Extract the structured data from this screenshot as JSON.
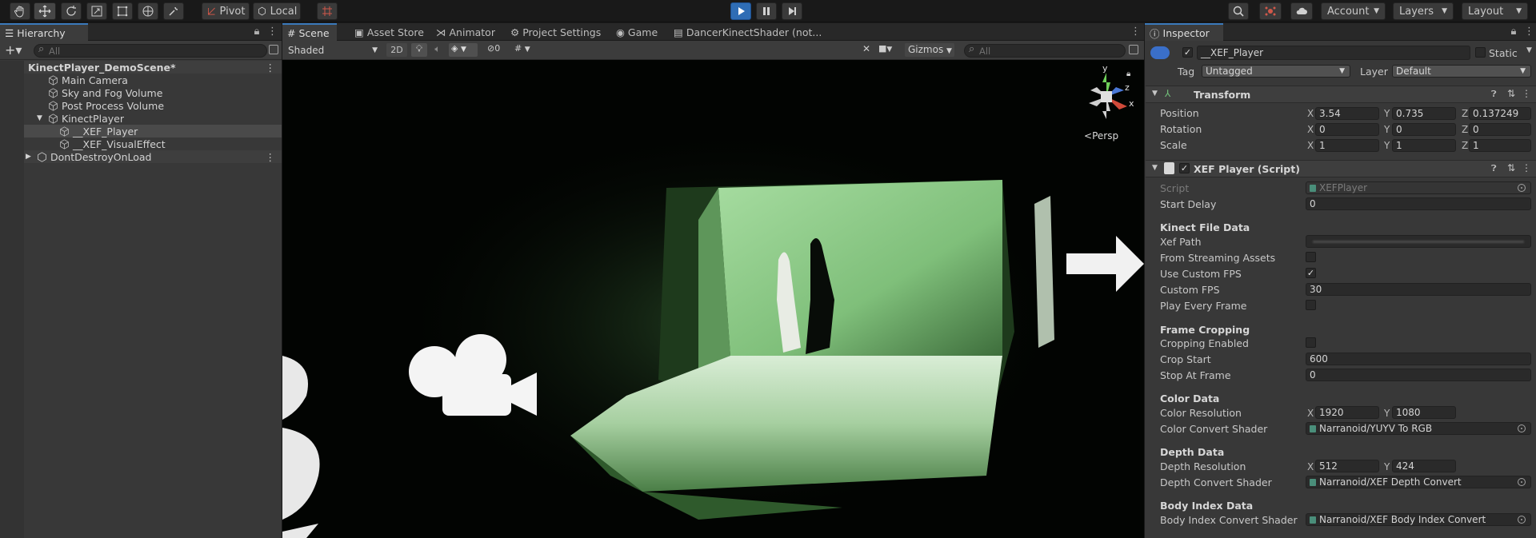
{
  "toolbar": {
    "pivot": "Pivot",
    "local": "Local",
    "account": "Account",
    "layers": "Layers",
    "layout": "Layout"
  },
  "hierarchy": {
    "tab": "Hierarchy",
    "search_placeholder": "All",
    "items": [
      {
        "label": "KinectPlayer_DemoScene*"
      },
      {
        "label": "Main Camera"
      },
      {
        "label": "Sky and Fog Volume"
      },
      {
        "label": "Post Process Volume"
      },
      {
        "label": "KinectPlayer"
      },
      {
        "label": "__XEF_Player"
      },
      {
        "label": "__XEF_VisualEffect"
      },
      {
        "label": "DontDestroyOnLoad"
      }
    ]
  },
  "scene": {
    "tabs": [
      "Scene",
      "Asset Store",
      "Animator",
      "Project Settings",
      "Game",
      "DancerKinectShader (not..."
    ],
    "shading": "Shaded",
    "mode_2d": "2D",
    "hidden_count": "0",
    "gizmos": "Gizmos",
    "search_placeholder": "All",
    "persp": "Persp",
    "axis_labels": {
      "y": "y",
      "z": "z",
      "x": "x"
    }
  },
  "inspector": {
    "tab": "Inspector",
    "object_name": "__XEF_Player",
    "static_label": "Static",
    "tag_label": "Tag",
    "tag_value": "Untagged",
    "layer_label": "Layer",
    "layer_value": "Default",
    "transform": {
      "title": "Transform",
      "position_label": "Position",
      "rotation_label": "Rotation",
      "scale_label": "Scale",
      "position": {
        "x": "3.54",
        "y": "0.735",
        "z": "0.137249"
      },
      "rotation": {
        "x": "0",
        "y": "0",
        "z": "0"
      },
      "scale": {
        "x": "1",
        "y": "1",
        "z": "1"
      }
    },
    "xef": {
      "title": "XEF Player (Script)",
      "script_label": "Script",
      "script_value": "XEFPlayer",
      "start_delay_label": "Start Delay",
      "start_delay": "0",
      "kinect_header": "Kinect File Data",
      "xef_path_label": "Xef Path",
      "from_streaming_label": "From Streaming Assets",
      "use_custom_fps_label": "Use Custom FPS",
      "custom_fps_label": "Custom FPS",
      "custom_fps": "30",
      "play_every_frame_label": "Play Every Frame",
      "cropping_header": "Frame Cropping",
      "cropping_enabled_label": "Cropping Enabled",
      "crop_start_label": "Crop Start",
      "crop_start": "600",
      "stop_at_label": "Stop At Frame",
      "stop_at": "0",
      "color_header": "Color Data",
      "color_res_label": "Color Resolution",
      "color_res": {
        "x": "1920",
        "y": "1080"
      },
      "color_shader_label": "Color Convert Shader",
      "color_shader": "Narranoid/YUYV To RGB",
      "depth_header": "Depth Data",
      "depth_res_label": "Depth Resolution",
      "depth_res": {
        "x": "512",
        "y": "424"
      },
      "depth_shader_label": "Depth Convert Shader",
      "depth_shader": "Narranoid/XEF Depth Convert",
      "body_header": "Body Index Data",
      "body_shader_label": "Body Index Convert Shader",
      "body_shader": "Narranoid/XEF Body Index Convert"
    },
    "axis": {
      "x": "X",
      "y": "Y",
      "z": "Z"
    }
  },
  "colors": {
    "accent": "#3a79bb",
    "play": "#2f6db5",
    "green_screen": "#8ec98a"
  }
}
